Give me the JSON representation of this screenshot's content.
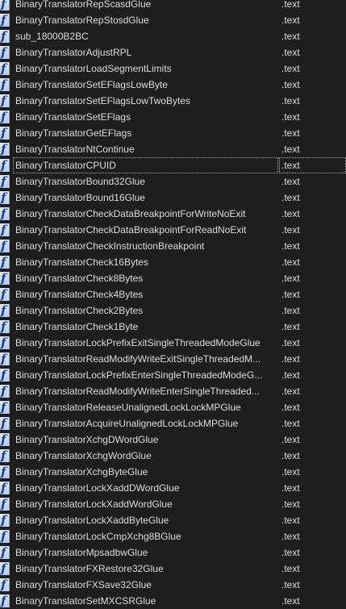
{
  "icon_glyph": "f",
  "icon_name": "function-icon",
  "selected_index": 10,
  "functions": [
    {
      "name": "BinaryTranslatorRepScasdGlue",
      "segment": ".text"
    },
    {
      "name": "BinaryTranslatorRepStosdGlue",
      "segment": ".text"
    },
    {
      "name": "sub_18000B2BC",
      "segment": ".text"
    },
    {
      "name": "BinaryTranslatorAdjustRPL",
      "segment": ".text"
    },
    {
      "name": "BinaryTranslatorLoadSegmentLimits",
      "segment": ".text"
    },
    {
      "name": "BinaryTranslatorSetEFlagsLowByte",
      "segment": ".text"
    },
    {
      "name": "BinaryTranslatorSetEFlagsLowTwoBytes",
      "segment": ".text"
    },
    {
      "name": "BinaryTranslatorSetEFlags",
      "segment": ".text"
    },
    {
      "name": "BinaryTranslatorGetEFlags",
      "segment": ".text"
    },
    {
      "name": "BinaryTranslatorNtContinue",
      "segment": ".text"
    },
    {
      "name": "BinaryTranslatorCPUID",
      "segment": ".text"
    },
    {
      "name": "BinaryTranslatorBound32Glue",
      "segment": ".text"
    },
    {
      "name": "BinaryTranslatorBound16Glue",
      "segment": ".text"
    },
    {
      "name": "BinaryTranslatorCheckDataBreakpointForWriteNoExit",
      "segment": ".text"
    },
    {
      "name": "BinaryTranslatorCheckDataBreakpointForReadNoExit",
      "segment": ".text"
    },
    {
      "name": "BinaryTranslatorCheckInstructionBreakpoint",
      "segment": ".text"
    },
    {
      "name": "BinaryTranslatorCheck16Bytes",
      "segment": ".text"
    },
    {
      "name": "BinaryTranslatorCheck8Bytes",
      "segment": ".text"
    },
    {
      "name": "BinaryTranslatorCheck4Bytes",
      "segment": ".text"
    },
    {
      "name": "BinaryTranslatorCheck2Bytes",
      "segment": ".text"
    },
    {
      "name": "BinaryTranslatorCheck1Byte",
      "segment": ".text"
    },
    {
      "name": "BinaryTranslatorLockPrefixExitSingleThreadedModeGlue",
      "segment": ".text"
    },
    {
      "name": "BinaryTranslatorReadModifyWriteExitSingleThreadedM...",
      "segment": ".text"
    },
    {
      "name": "BinaryTranslatorLockPrefixEnterSingleThreadedModeG...",
      "segment": ".text"
    },
    {
      "name": "BinaryTranslatorReadModifyWriteEnterSingleThreaded...",
      "segment": ".text"
    },
    {
      "name": "BinaryTranslatorReleaseUnalignedLockLockMPGlue",
      "segment": ".text"
    },
    {
      "name": "BinaryTranslatorAcquireUnalignedLockLockMPGlue",
      "segment": ".text"
    },
    {
      "name": "BinaryTranslatorXchgDWordGlue",
      "segment": ".text"
    },
    {
      "name": "BinaryTranslatorXchgWordGlue",
      "segment": ".text"
    },
    {
      "name": "BinaryTranslatorXchgByteGlue",
      "segment": ".text"
    },
    {
      "name": "BinaryTranslatorLockXaddDWordGlue",
      "segment": ".text"
    },
    {
      "name": "BinaryTranslatorLockXaddWordGlue",
      "segment": ".text"
    },
    {
      "name": "BinaryTranslatorLockXaddByteGlue",
      "segment": ".text"
    },
    {
      "name": "BinaryTranslatorLockCmpXchg8BGlue",
      "segment": ".text"
    },
    {
      "name": "BinaryTranslatorMpsadbwGlue",
      "segment": ".text"
    },
    {
      "name": "BinaryTranslatorFXRestore32Glue",
      "segment": ".text"
    },
    {
      "name": "BinaryTranslatorFXSave32Glue",
      "segment": ".text"
    },
    {
      "name": "BinaryTranslatorSetMXCSRGlue",
      "segment": ".text"
    }
  ]
}
